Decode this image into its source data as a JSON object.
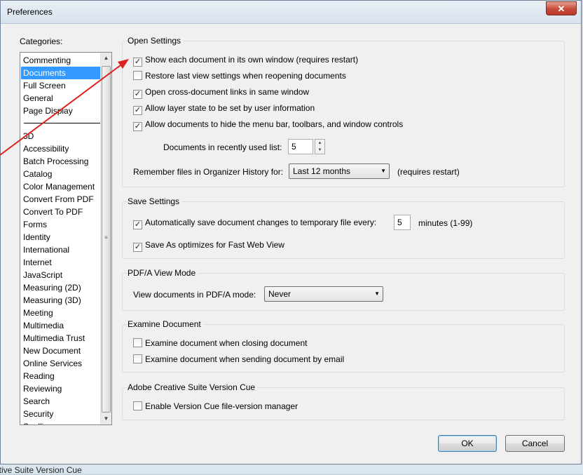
{
  "window": {
    "title": "Preferences",
    "close_glyph": "✕"
  },
  "categories": {
    "label": "Categories:",
    "items_top": [
      "Commenting",
      "Documents",
      "Full Screen",
      "General",
      "Page Display"
    ],
    "items_bottom": [
      "3D",
      "Accessibility",
      "Batch Processing",
      "Catalog",
      "Color Management",
      "Convert From PDF",
      "Convert To PDF",
      "Forms",
      "Identity",
      "International",
      "Internet",
      "JavaScript",
      "Measuring (2D)",
      "Measuring (3D)",
      "Meeting",
      "Multimedia",
      "Multimedia Trust",
      "New Document",
      "Online Services",
      "Reading",
      "Reviewing",
      "Search",
      "Security",
      "Spelling"
    ],
    "selected": "Documents"
  },
  "open_settings": {
    "title": "Open Settings",
    "options": [
      {
        "label": "Show each document in its own window (requires restart)",
        "checked": true
      },
      {
        "label": "Restore last view settings when reopening documents",
        "checked": false
      },
      {
        "label": "Open cross-document links in same window",
        "checked": true
      },
      {
        "label": "Allow layer state to be set by user information",
        "checked": true
      },
      {
        "label": "Allow documents to hide the menu bar, toolbars, and window controls",
        "checked": true
      }
    ],
    "recent_label": "Documents in recently used list:",
    "recent_value": "5",
    "organizer_label": "Remember files in Organizer History for:",
    "organizer_value": "Last 12 months",
    "organizer_note": "(requires restart)"
  },
  "save_settings": {
    "title": "Save Settings",
    "autosave_label": "Automatically save document changes to temporary file every:",
    "autosave_checked": true,
    "autosave_value": "5",
    "autosave_unit": "minutes (1-99)",
    "fastweb_label": "Save As optimizes for Fast Web View",
    "fastweb_checked": true
  },
  "pdfa": {
    "title": "PDF/A View Mode",
    "label": "View documents in PDF/A mode:",
    "value": "Never"
  },
  "examine": {
    "title": "Examine Document",
    "options": [
      {
        "label": "Examine document when closing document",
        "checked": false
      },
      {
        "label": "Examine document when sending document by email",
        "checked": false
      }
    ]
  },
  "version_cue": {
    "title": "Adobe Creative Suite Version Cue",
    "label": "Enable Version Cue file-version manager",
    "checked": false
  },
  "buttons": {
    "ok": "OK",
    "cancel": "Cancel"
  },
  "background_text": "ative Suite Version Cue",
  "colors": {
    "selection": "#3399ff",
    "annotation_arrow": "#e02020"
  }
}
